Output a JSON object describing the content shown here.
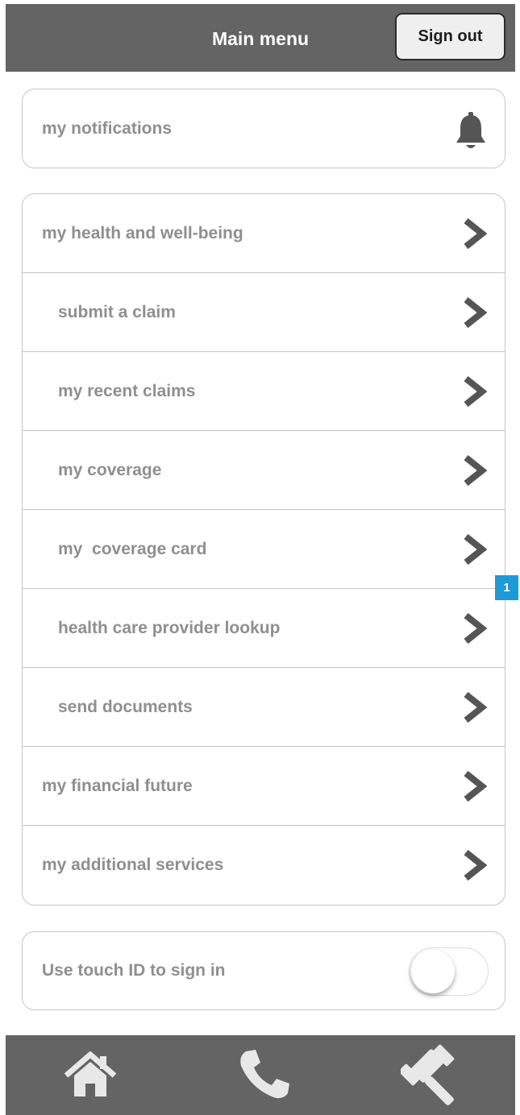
{
  "header": {
    "title": "Main menu",
    "signout_label": "Sign out"
  },
  "notifications": {
    "label": "my notifications",
    "icon": "bell-icon"
  },
  "menu": {
    "items": [
      {
        "label": "my health and well-being",
        "level": 0
      },
      {
        "label": "submit a claim",
        "level": 1
      },
      {
        "label": "my recent claims",
        "level": 1
      },
      {
        "label": "my coverage",
        "level": 1
      },
      {
        "label": "my  coverage card",
        "level": 1
      },
      {
        "label": "health care provider lookup",
        "level": 1
      },
      {
        "label": "send documents",
        "level": 1
      },
      {
        "label": "my financial future",
        "level": 0
      },
      {
        "label": "my additional services",
        "level": 0
      }
    ],
    "chevron_icon": "chevron-right-icon"
  },
  "touch_id": {
    "label": "Use touch ID to sign in",
    "enabled": false
  },
  "annotation_badge": "1",
  "bottom_nav": {
    "icons": [
      "home-icon",
      "phone-icon",
      "gavel-icon"
    ]
  },
  "colors": {
    "bar_background": "#646464",
    "text_gray": "#8f8f8f",
    "border_gray": "#c6c6c6",
    "badge_blue": "#1e9ad6"
  }
}
